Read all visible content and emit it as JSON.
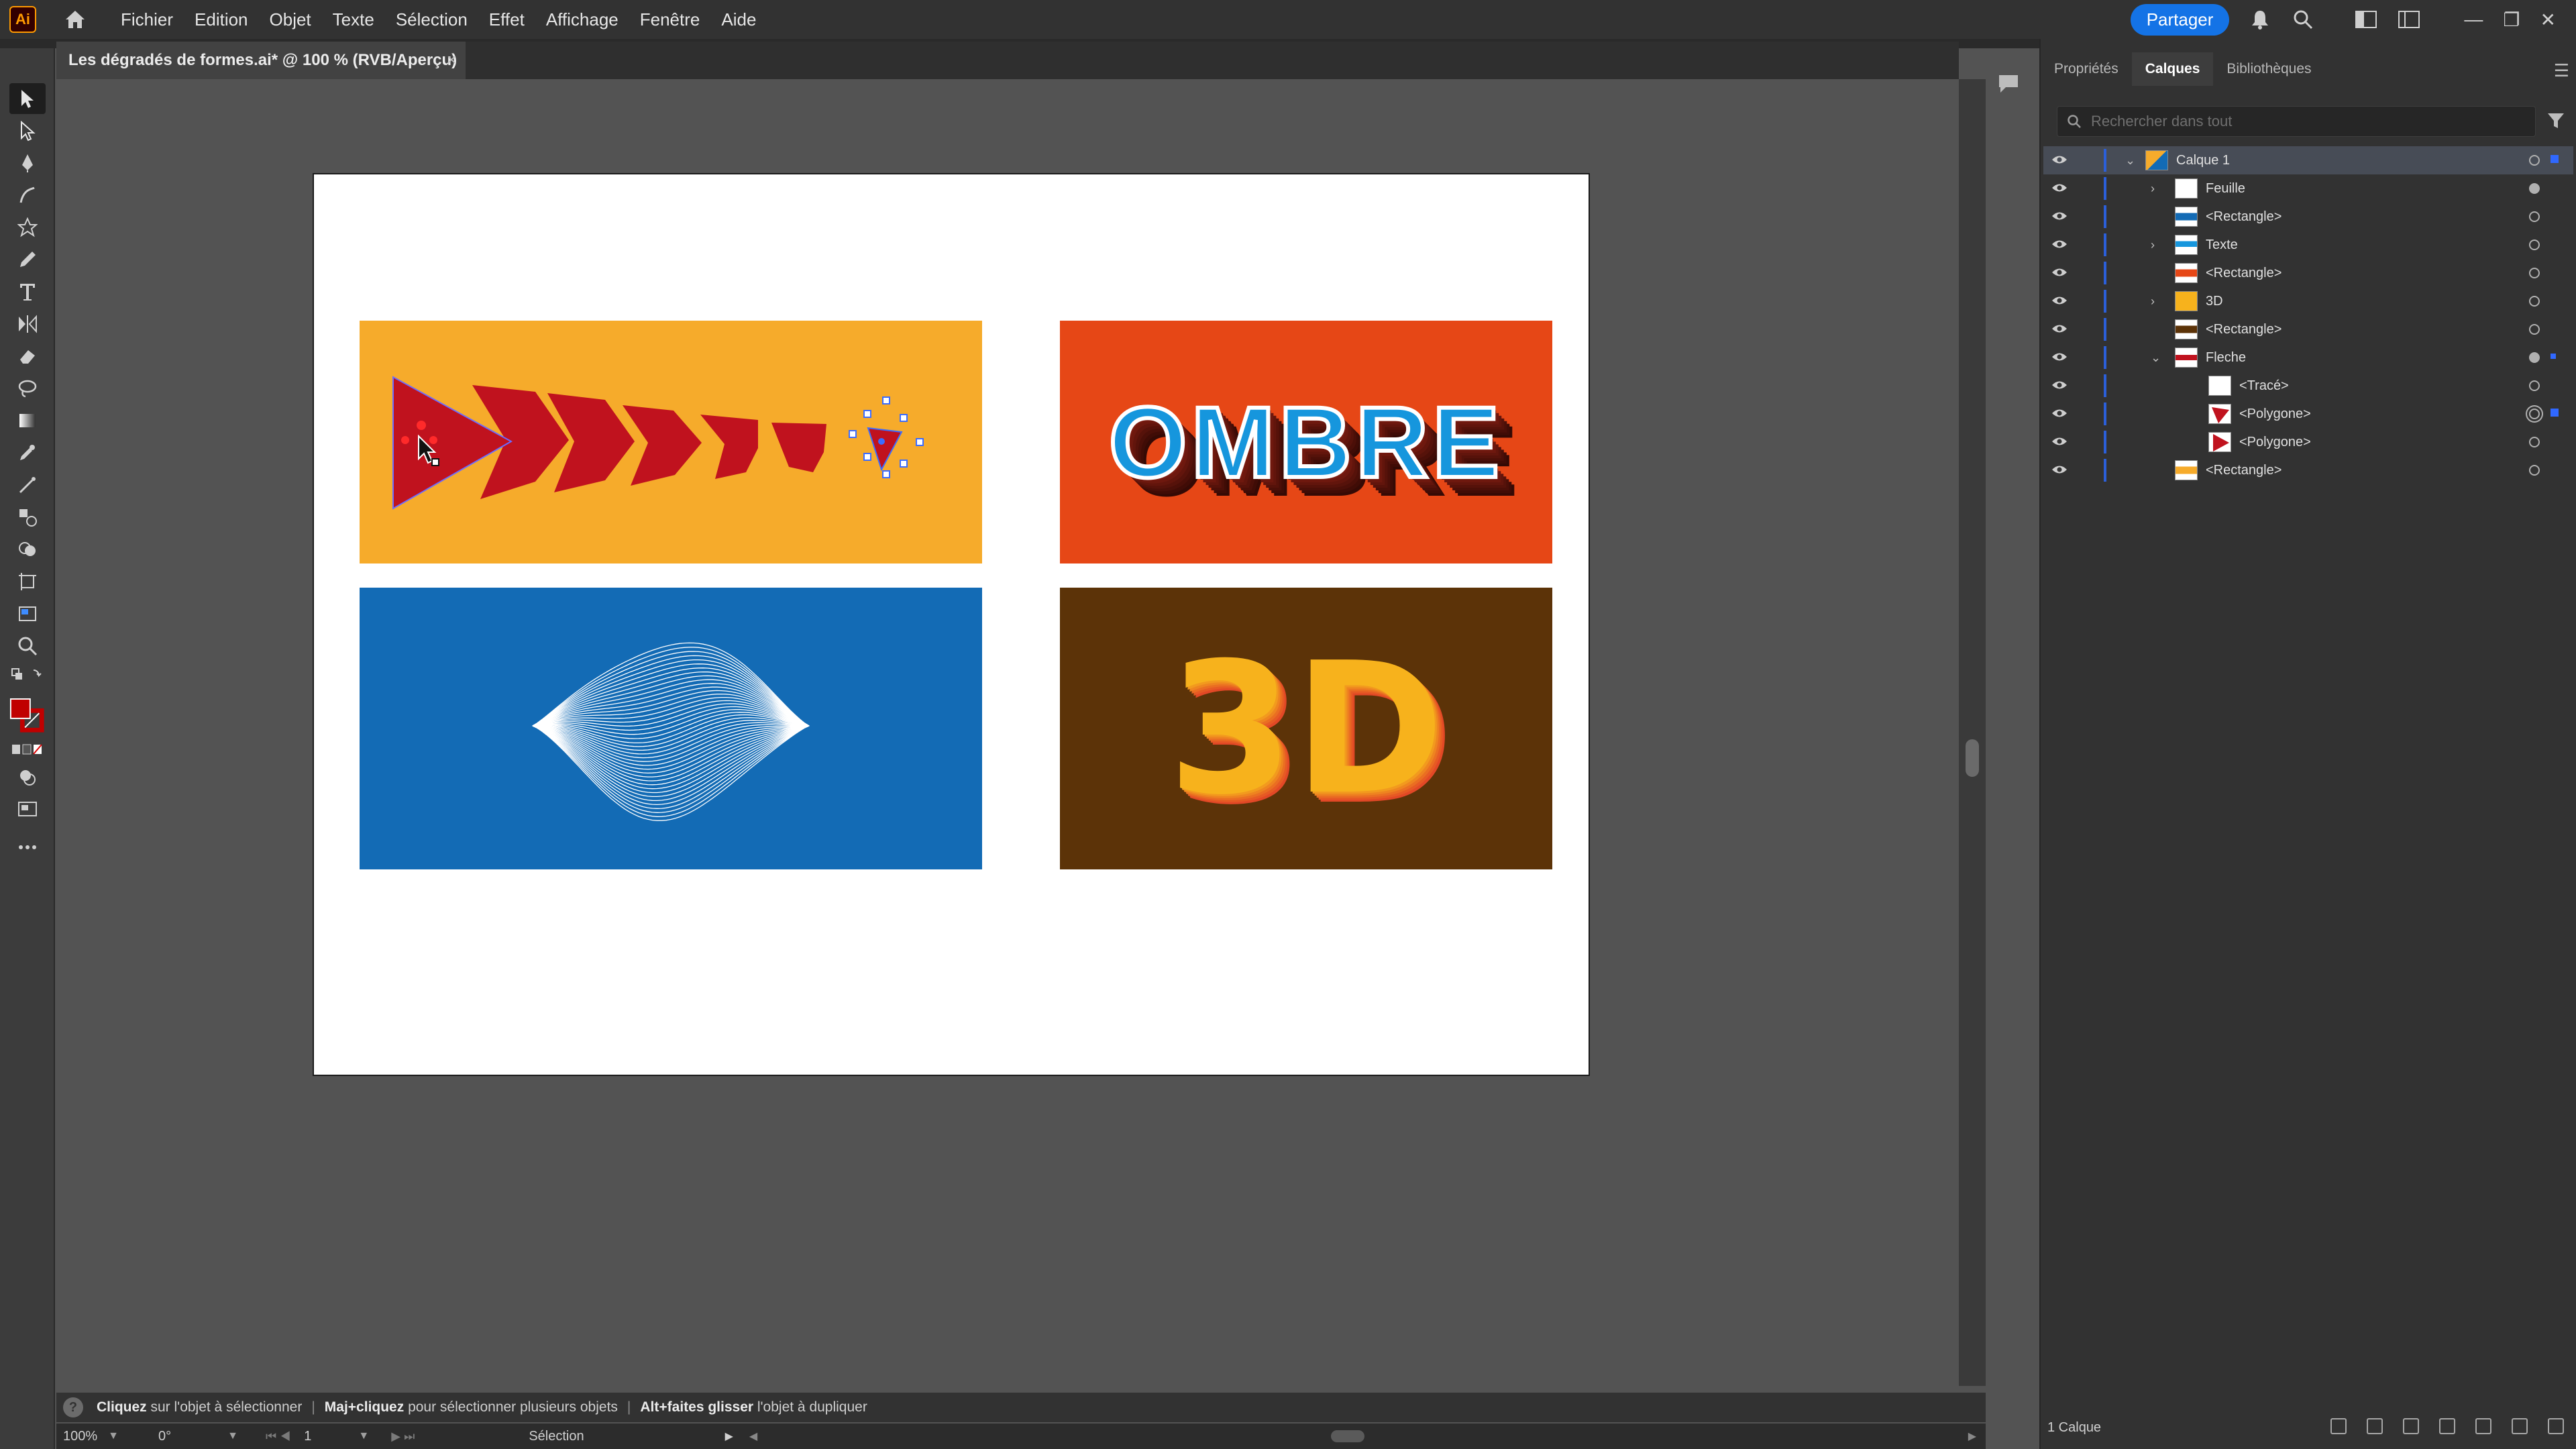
{
  "app": {
    "logo": "Ai",
    "share_label": "Partager"
  },
  "menu": [
    "Fichier",
    "Edition",
    "Objet",
    "Texte",
    "Sélection",
    "Effet",
    "Affichage",
    "Fenêtre",
    "Aide"
  ],
  "document": {
    "tab_title": "Les dégradés de formes.ai* @ 100 % (RVB/Aperçu)",
    "close_glyph": "×"
  },
  "artwork": {
    "ombre_text": "OMBRE",
    "three_d_text": "3D",
    "colors": {
      "orange": "#f6ab2b",
      "red_orange": "#e64716",
      "blue": "#136bb5",
      "brown": "#5c3308",
      "arrow": "#c0121e"
    }
  },
  "tools": [
    "selection-tool",
    "direct-selection-tool",
    "pen-tool",
    "curvature-tool",
    "star-tool",
    "pencil-tool",
    "type-tool",
    "reflect-tool",
    "eraser-tool",
    "lasso-tool",
    "gradient-tool",
    "eyedropper-tool",
    "measure-tool",
    "blend-tool",
    "shape-builder-tool",
    "artboard-tool",
    "hand-tool",
    "zoom-tool"
  ],
  "hint": {
    "part1_bold": "Cliquez",
    "part1": " sur l'objet à sélectionner",
    "part2_bold": "Maj+cliquez",
    "part2": " pour sélectionner plusieurs objets",
    "part3_bold": "Alt+faites glisser",
    "part3": " l'objet à dupliquer",
    "separator": "|"
  },
  "status": {
    "zoom": "100%",
    "rotation": "0°",
    "artboard": "1",
    "mode": "Sélection"
  },
  "panel": {
    "tabs": [
      "Propriétés",
      "Calques",
      "Bibliothèques"
    ],
    "active_tab": "Calques",
    "search_placeholder": "Rechercher dans tout",
    "footer_label": "1 Calque",
    "layers": [
      {
        "name": "Calque 1",
        "depth": 0,
        "twirl": "down",
        "selected": true
      },
      {
        "name": "Feuille",
        "depth": 1,
        "twirl": "right"
      },
      {
        "name": "<Rectangle>",
        "depth": 1,
        "twirl": ""
      },
      {
        "name": "Texte",
        "depth": 1,
        "twirl": "right"
      },
      {
        "name": "<Rectangle>",
        "depth": 1,
        "twirl": ""
      },
      {
        "name": "3D",
        "depth": 1,
        "twirl": "right"
      },
      {
        "name": "<Rectangle>",
        "depth": 1,
        "twirl": ""
      },
      {
        "name": "Fleche",
        "depth": 1,
        "twirl": "down"
      },
      {
        "name": "<Tracé>",
        "depth": 2,
        "twirl": ""
      },
      {
        "name": "<Polygone>",
        "depth": 2,
        "twirl": ""
      },
      {
        "name": "<Polygone>",
        "depth": 2,
        "twirl": ""
      },
      {
        "name": "<Rectangle>",
        "depth": 1,
        "twirl": ""
      }
    ]
  }
}
